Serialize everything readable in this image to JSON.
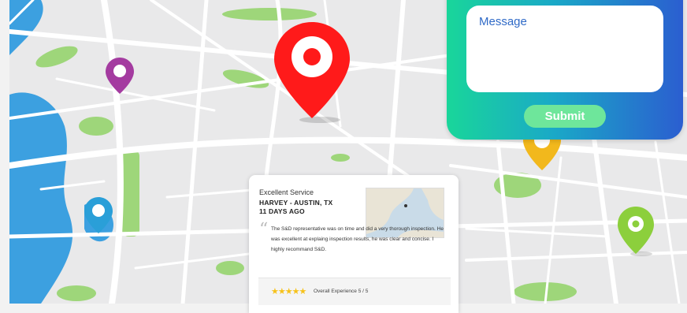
{
  "map": {
    "colors": {
      "land": "#e9e9ea",
      "road": "#ffffff",
      "water": "#3ca0e0",
      "park": "#9ed67a"
    },
    "pins": [
      {
        "name": "red-location-pin",
        "color": "#ff1a1a"
      },
      {
        "name": "purple-location-pin",
        "color": "#a43ba0"
      },
      {
        "name": "blue-location-pin",
        "color": "#2a9fd8"
      },
      {
        "name": "yellow-location-pin",
        "color": "#f2b81c"
      },
      {
        "name": "green-location-pin",
        "color": "#8ccf3c"
      }
    ]
  },
  "contact_form": {
    "message_placeholder": "Message",
    "submit_label": "Submit"
  },
  "review": {
    "title": "Excellent Service",
    "author": "HARVEY - AUSTIN, TX",
    "date": "11 DAYS AGO",
    "quote_mark": "“",
    "body": "The S&D representative was on time and did a very thorough inspection. He was excellent at explaing inspection results, he was clear and concise. I highly recommand S&D.",
    "stars": "★★★★★",
    "overall": "Overall Experience 5 / 5"
  }
}
